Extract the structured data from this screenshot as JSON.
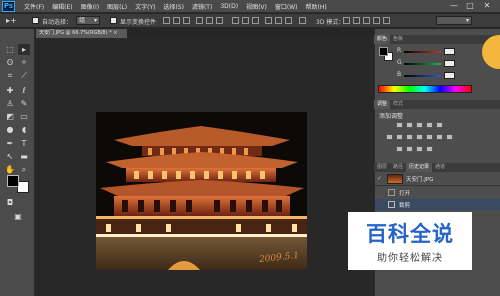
{
  "app": {
    "logo": "Ps"
  },
  "menu": [
    "文件(F)",
    "编辑(E)",
    "图像(I)",
    "图层(L)",
    "文字(Y)",
    "选择(S)",
    "滤镜(T)",
    "3D(D)",
    "视图(V)",
    "窗口(W)",
    "帮助(H)"
  ],
  "window_controls": {
    "minimize": "—",
    "restore": "□",
    "close": "✕"
  },
  "options_bar": {
    "auto_select_label": "自动选择：",
    "auto_select_value": "组",
    "show_transform_label": "显示变换控件",
    "mode_3d_label": "3D 模式："
  },
  "document": {
    "tab_title": "天安门.JPG @ 66.7%(RGB/8) *",
    "close_glyph": "×",
    "photo_signature": "2009.5.1"
  },
  "color_panel": {
    "tabs": [
      "颜色",
      "色板"
    ],
    "channels": [
      {
        "label": "R",
        "color": "#c0392b",
        "value": ""
      },
      {
        "label": "G",
        "color": "#27ae60",
        "value": ""
      },
      {
        "label": "B",
        "color": "#2e5bd6",
        "value": ""
      }
    ],
    "foreground": "#000000",
    "background": "#ffffff"
  },
  "adjust_panel": {
    "tabs": [
      "调整",
      "样式"
    ],
    "title": "添加调整"
  },
  "history_panel": {
    "tabs": [
      "图层",
      "路径",
      "历史记录",
      "通道"
    ],
    "snapshot_label": "天安门.JPG",
    "items": [
      "打开",
      "裁剪"
    ]
  },
  "watermark": {
    "title": "百科全说",
    "subtitle": "助你轻松解决",
    "title_color": "#2463c7"
  }
}
